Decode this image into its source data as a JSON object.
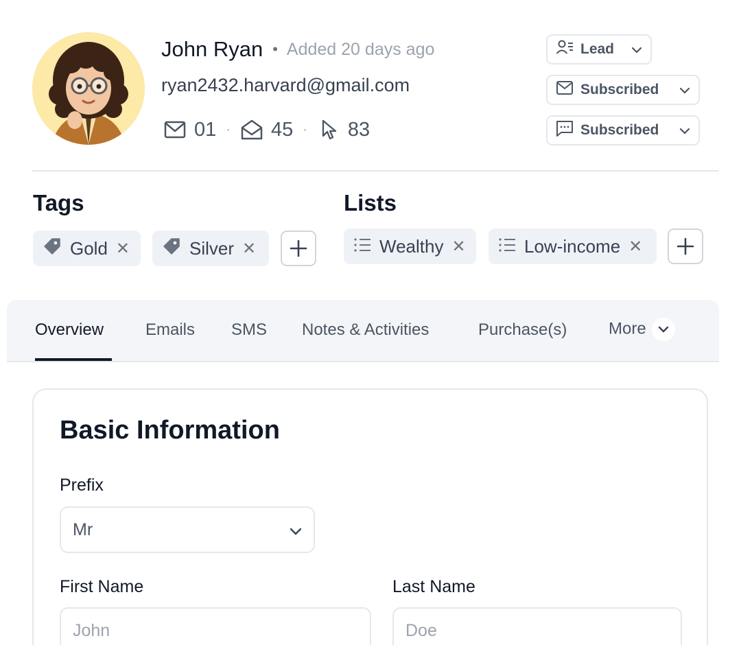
{
  "contact": {
    "name": "John Ryan",
    "added": "Added 20 days ago",
    "email": "ryan2432.harvard@gmail.com",
    "stats": {
      "emails_sent": "01",
      "emails_opened": "45",
      "clicks": "83"
    }
  },
  "status": {
    "lifecycle": "Lead",
    "email_subscription": "Subscribed",
    "sms_subscription": "Subscribed"
  },
  "tags": {
    "title": "Tags",
    "items": [
      "Gold",
      "Silver"
    ]
  },
  "lists": {
    "title": "Lists",
    "items": [
      "Wealthy",
      "Low-income"
    ]
  },
  "tabs": [
    "Overview",
    "Emails",
    "SMS",
    "Notes & Activities",
    "Purchase(s)",
    "More"
  ],
  "active_tab": "Overview",
  "basic_info": {
    "title": "Basic Information",
    "prefix_label": "Prefix",
    "prefix_value": "Mr",
    "first_name_label": "First Name",
    "first_name_placeholder": "John",
    "last_name_label": "Last Name",
    "last_name_placeholder": "Doe"
  },
  "colors": {
    "chip_bg": "#eef2f6",
    "border": "#e5e7eb",
    "text_dark": "#111827",
    "text_muted": "#9ca3af",
    "avatar_bg": "#fde9a8"
  }
}
